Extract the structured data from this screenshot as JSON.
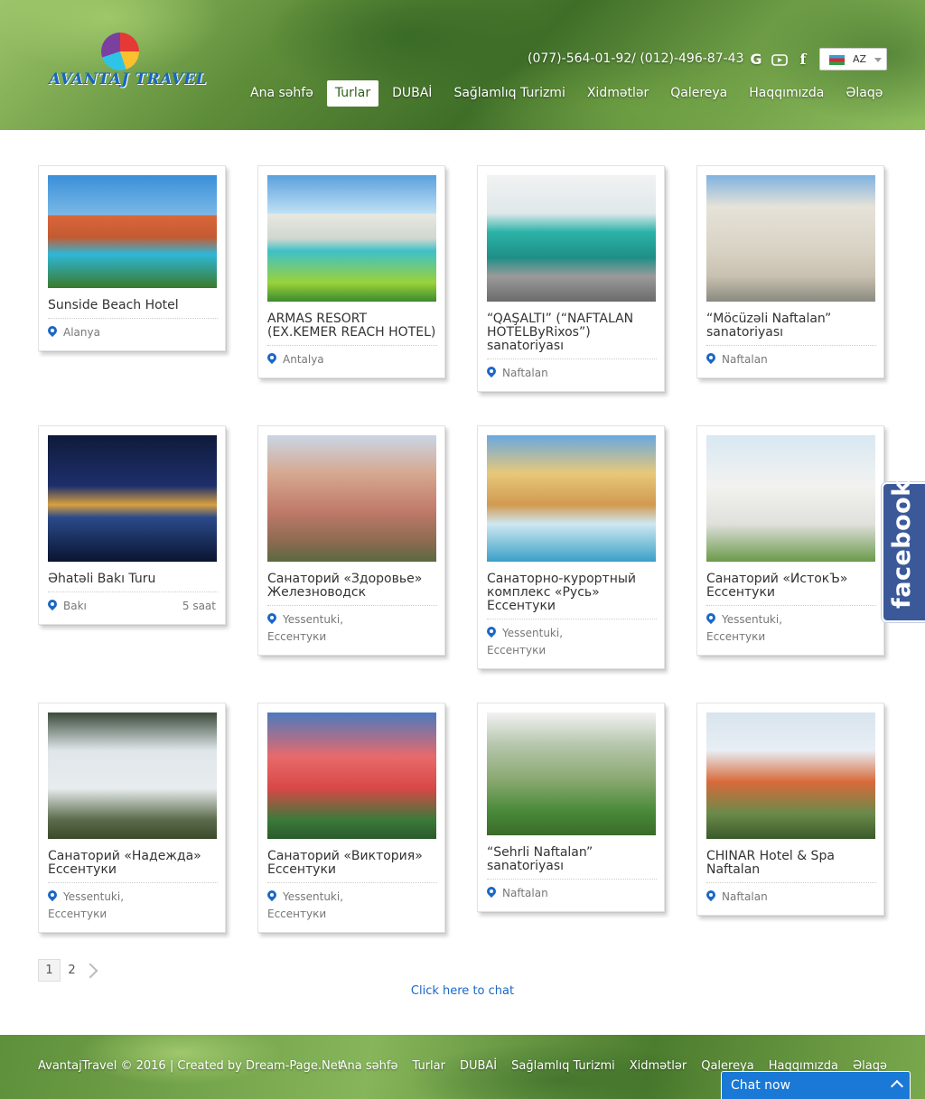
{
  "site": {
    "logo_text": "AVANTAJ TRAVEL",
    "phone": "(077)-564-01-92/ (012)-496-87-43",
    "social_icons": [
      "google-icon",
      "youtube-icon",
      "facebook-icon"
    ],
    "language": {
      "code": "AZ",
      "flag": "azerbaijan-flag"
    }
  },
  "nav": [
    {
      "label": "Ana səhfə",
      "active": false
    },
    {
      "label": "Turlar",
      "active": true
    },
    {
      "label": "DUBAİ",
      "active": false
    },
    {
      "label": "Sağlamlıq Turizmi",
      "active": false
    },
    {
      "label": "Xidmətlər",
      "active": false
    },
    {
      "label": "Qalereya",
      "active": false
    },
    {
      "label": "Haqqımızda",
      "active": false
    },
    {
      "label": "Əlaqə",
      "active": false
    }
  ],
  "tours": [
    {
      "title": "Sunside Beach Hotel",
      "location": "Alanya",
      "location2": "",
      "duration": ""
    },
    {
      "title": "ARMAS RESORT (EX.KEMER REACH HOTEL)",
      "location": "Antalya",
      "location2": "",
      "duration": ""
    },
    {
      "title": "“QAŞALTI” (“NAFTALAN HOTELByRixos”) sanatoriyası",
      "location": "Naftalan",
      "location2": "",
      "duration": ""
    },
    {
      "title": "“Möcüzəli Naftalan” sanatoriyası",
      "location": "Naftalan",
      "location2": "",
      "duration": ""
    },
    {
      "title": "Əhatəli Bakı Turu",
      "location": "Bakı",
      "location2": "",
      "duration": "5 saat"
    },
    {
      "title": "Санаторий «Здоровье» Железноводск",
      "location": "Yessentuki,",
      "location2": "Ессентуки",
      "duration": ""
    },
    {
      "title": "Санаторно-курортный комплекс «Русь» Ессентуки",
      "location": "Yessentuki,",
      "location2": "Ессентуки",
      "duration": ""
    },
    {
      "title": "Санаторий «ИстокЪ» Ессентуки",
      "location": "Yessentuki,",
      "location2": "Ессентуки",
      "duration": ""
    },
    {
      "title": "Санаторий «Надежда» Ессентуки",
      "location": "Yessentuki,",
      "location2": "Ессентуки",
      "duration": ""
    },
    {
      "title": "Санаторий «Виктория» Ессентуки",
      "location": "Yessentuki,",
      "location2": "Ессентуки",
      "duration": ""
    },
    {
      "title": "“Sehrli Naftalan” sanatoriyası",
      "location": "Naftalan",
      "location2": "",
      "duration": ""
    },
    {
      "title": "CHINAR Hotel & Spa Naftalan",
      "location": "Naftalan",
      "location2": "",
      "duration": ""
    }
  ],
  "pagination": {
    "pages": [
      "1",
      "2"
    ],
    "current": "1"
  },
  "chat_link": "Click here to chat",
  "facebook_tab": "facebook",
  "footer": {
    "copyright": "AvantajTravel © 2016 | Created by Dream-Page.Net",
    "nav": [
      "Ana səhfə",
      "Turlar",
      "DUBAİ",
      "Sağlamlıq Turizmi",
      "Xidmətlər",
      "Qalereya",
      "Haqqımızda",
      "Əlaqə"
    ]
  },
  "chat_bar": {
    "label": "Chat now"
  }
}
